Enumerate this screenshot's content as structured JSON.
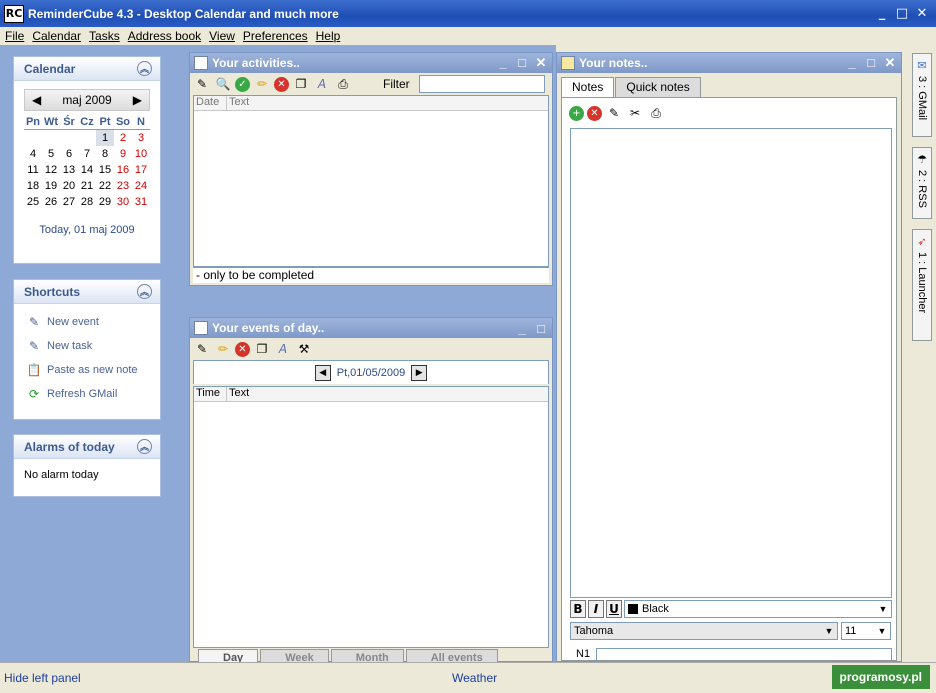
{
  "window": {
    "logo": "RC",
    "title": "ReminderCube 4.3 - Desktop Calendar and much more",
    "controls": [
      "_",
      "□",
      "✕"
    ]
  },
  "menu": [
    "File",
    "Calendar",
    "Tasks",
    "Address book",
    "View",
    "Preferences",
    "Help"
  ],
  "calendar": {
    "title": "Calendar",
    "month_label": "maj 2009",
    "day_headers": [
      "Pn",
      "Wt",
      "Śr",
      "Cz",
      "Pt",
      "So",
      "N"
    ],
    "weeks": [
      [
        "",
        "",
        "",
        "",
        "1",
        "2",
        "3"
      ],
      [
        "4",
        "5",
        "6",
        "7",
        "8",
        "9",
        "10"
      ],
      [
        "11",
        "12",
        "13",
        "14",
        "15",
        "16",
        "17"
      ],
      [
        "18",
        "19",
        "20",
        "21",
        "22",
        "23",
        "24"
      ],
      [
        "25",
        "26",
        "27",
        "28",
        "29",
        "30",
        "31"
      ]
    ],
    "today_text": "Today, 01 maj 2009"
  },
  "shortcuts": {
    "title": "Shortcuts",
    "items": [
      {
        "label": "New event",
        "icon": "new-event-icon"
      },
      {
        "label": "New task",
        "icon": "new-task-icon"
      },
      {
        "label": "Paste as new note",
        "icon": "paste-note-icon"
      },
      {
        "label": "Refresh GMail",
        "icon": "refresh-gmail-icon"
      }
    ]
  },
  "alarms": {
    "title": "Alarms of today",
    "text": "No alarm today"
  },
  "activities": {
    "title": "Your activities..",
    "filter_label": "Filter",
    "filter_value": "",
    "columns": [
      "Date",
      "Text"
    ],
    "status": "- only to be completed"
  },
  "events": {
    "title": "Your events of day..",
    "date_label": "Pt,01/05/2009",
    "columns": [
      "Time",
      "Text"
    ],
    "tabs": [
      "Day",
      "Week",
      "Month",
      "All events"
    ]
  },
  "notes": {
    "title": "Your notes..",
    "tabs": [
      "Notes",
      "Quick notes"
    ],
    "color_value": "Black",
    "font_value": "Tahoma",
    "size_value": "11",
    "note_label": "N1"
  },
  "right_tabs": [
    "3 : GMail",
    "2 : RSS",
    "1 : Launcher"
  ],
  "statusbar": {
    "hide_label": "Hide left panel",
    "weather_label": "Weather",
    "watermark": "programosy.pl"
  }
}
